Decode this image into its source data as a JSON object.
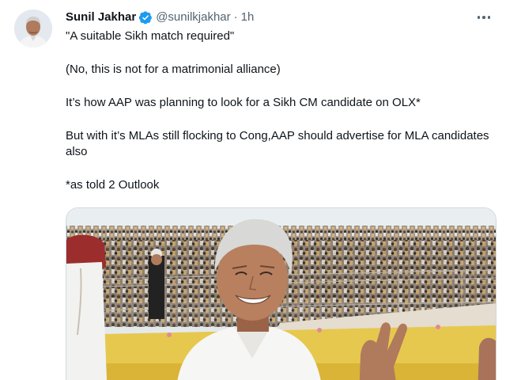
{
  "author": {
    "name": "Sunil Jakhar",
    "handle": "@sunilkjakhar",
    "separator": "·",
    "time": "1h",
    "verified": true
  },
  "icons": {
    "more": "more-horizontal-icon",
    "verified": "verified-badge-icon"
  },
  "tweet": {
    "paragraphs": [
      "\"A suitable Sikh match required\"",
      "(No, this is not for a matrimonial alliance)",
      "It’s how AAP was planning to look for a Sikh CM candidate on OLX*",
      "But with it’s MLAs still flocking to Cong,AAP should advertise for MLA candidates also",
      "*as told 2 Outlook"
    ]
  },
  "colors": {
    "verified": "#1d9bf0",
    "secondary_text": "#536471",
    "primary_text": "#0f1419"
  }
}
